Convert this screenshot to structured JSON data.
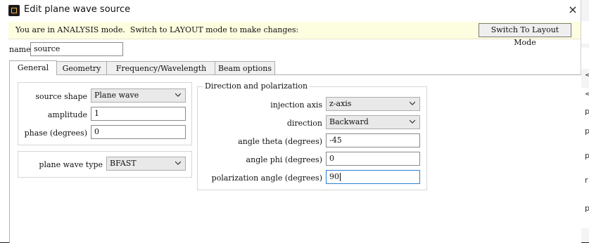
{
  "window": {
    "title": "Edit plane wave source",
    "close_icon": "×"
  },
  "banner": {
    "message": "You are in ANALYSIS mode.  Switch to LAYOUT mode to make changes:",
    "button_label": "Switch To Layout Mode",
    "background": "#fdfde0"
  },
  "name": {
    "label": "name",
    "value": "source"
  },
  "tabs": [
    {
      "label": "General",
      "active": true
    },
    {
      "label": "Geometry",
      "active": false
    },
    {
      "label": "Frequency/Wavelength",
      "active": false
    },
    {
      "label": "Beam options",
      "active": false
    }
  ],
  "general": {
    "source_shape": {
      "label": "source shape",
      "value": "Plane wave"
    },
    "amplitude": {
      "label": "amplitude",
      "value": "1"
    },
    "phase": {
      "label": "phase (degrees)",
      "value": "0"
    },
    "plane_wave_type": {
      "label": "plane wave type",
      "value": "BFAST"
    }
  },
  "direction_polarization": {
    "legend": "Direction and polarization",
    "injection_axis": {
      "label": "injection axis",
      "value": "z-axis"
    },
    "direction": {
      "label": "direction",
      "value": "Backward"
    },
    "angle_theta": {
      "label": "angle theta (degrees)",
      "value": "-45"
    },
    "angle_phi": {
      "label": "angle phi (degrees)",
      "value": "0"
    },
    "polarization_angle": {
      "label": "polarization angle (degrees)",
      "value": "90"
    }
  },
  "right_edge_chars": [
    "<",
    "<",
    "p",
    "p",
    "p",
    "r",
    "p"
  ],
  "colors": {
    "focus_border": "#2a7fd4",
    "tab_border": "#adadad"
  }
}
